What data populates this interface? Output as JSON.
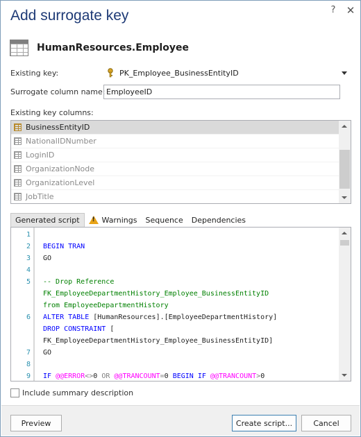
{
  "dialog": {
    "title": "Add surrogate key",
    "help_glyph": "?",
    "close_glyph": "✕"
  },
  "object": {
    "name": "HumanResources.Employee"
  },
  "form": {
    "existing_key_label": "Existing key:",
    "existing_key_value": "PK_Employee_BusinessEntityID",
    "surrogate_label": "Surrogate column name:",
    "surrogate_value": "EmployeeID",
    "key_columns_label": "Existing key columns:"
  },
  "key_columns": [
    {
      "name": "BusinessEntityID",
      "selected": true
    },
    {
      "name": "NationalIDNumber",
      "selected": false
    },
    {
      "name": "LoginID",
      "selected": false
    },
    {
      "name": "OrganizationNode",
      "selected": false
    },
    {
      "name": "OrganizationLevel",
      "selected": false
    },
    {
      "name": "JobTitle",
      "selected": false
    }
  ],
  "tabs": [
    {
      "label": "Generated script",
      "active": true
    },
    {
      "label": "Warnings",
      "icon": "warning-icon"
    },
    {
      "label": "Sequence"
    },
    {
      "label": "Dependencies"
    }
  ],
  "script": {
    "line_numbers": [
      "1",
      "2",
      "3",
      "4",
      "5",
      "6",
      "7",
      "8",
      "9"
    ],
    "lines": [
      "BEGIN TRAN",
      "GO",
      "-- Drop Reference",
      "FK_EmployeeDepartmentHistory_Employee_BusinessEntityID",
      "from EmployeeDepartmentHistory",
      "ALTER TABLE [HumanResources].[EmployeeDepartmentHistory]",
      "DROP CONSTRAINT [",
      "FK_EmployeeDepartmentHistory_Employee_BusinessEntityID]",
      "GO",
      "IF @@ERROR<>0 OR @@TRANCOUNT=0 BEGIN IF @@TRANCOUNT>0"
    ]
  },
  "options": {
    "include_summary_label": "Include summary description",
    "include_summary_checked": false
  },
  "buttons": {
    "preview": "Preview",
    "create_script": "Create script...",
    "cancel": "Cancel"
  },
  "colors": {
    "title": "#1e3a76",
    "keyword": "#0000ff",
    "comment": "#008000",
    "line_number": "#2b91af",
    "system_var": "#ff00ff"
  }
}
